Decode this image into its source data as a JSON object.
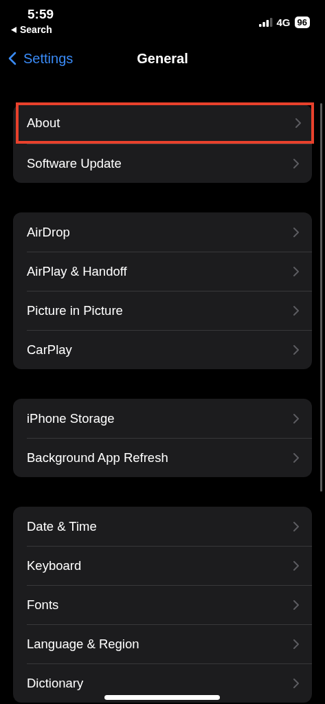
{
  "status_bar": {
    "time": "5:59",
    "back_app": "Search",
    "network": "4G",
    "battery": "96"
  },
  "nav": {
    "back": "Settings",
    "title": "General"
  },
  "groups": [
    {
      "items": [
        {
          "label": "About",
          "highlighted": true
        },
        {
          "label": "Software Update",
          "highlighted": false
        }
      ]
    },
    {
      "items": [
        {
          "label": "AirDrop",
          "highlighted": false
        },
        {
          "label": "AirPlay & Handoff",
          "highlighted": false
        },
        {
          "label": "Picture in Picture",
          "highlighted": false
        },
        {
          "label": "CarPlay",
          "highlighted": false
        }
      ]
    },
    {
      "items": [
        {
          "label": "iPhone Storage",
          "highlighted": false
        },
        {
          "label": "Background App Refresh",
          "highlighted": false
        }
      ]
    },
    {
      "items": [
        {
          "label": "Date & Time",
          "highlighted": false
        },
        {
          "label": "Keyboard",
          "highlighted": false
        },
        {
          "label": "Fonts",
          "highlighted": false
        },
        {
          "label": "Language & Region",
          "highlighted": false
        },
        {
          "label": "Dictionary",
          "highlighted": false
        }
      ]
    }
  ]
}
